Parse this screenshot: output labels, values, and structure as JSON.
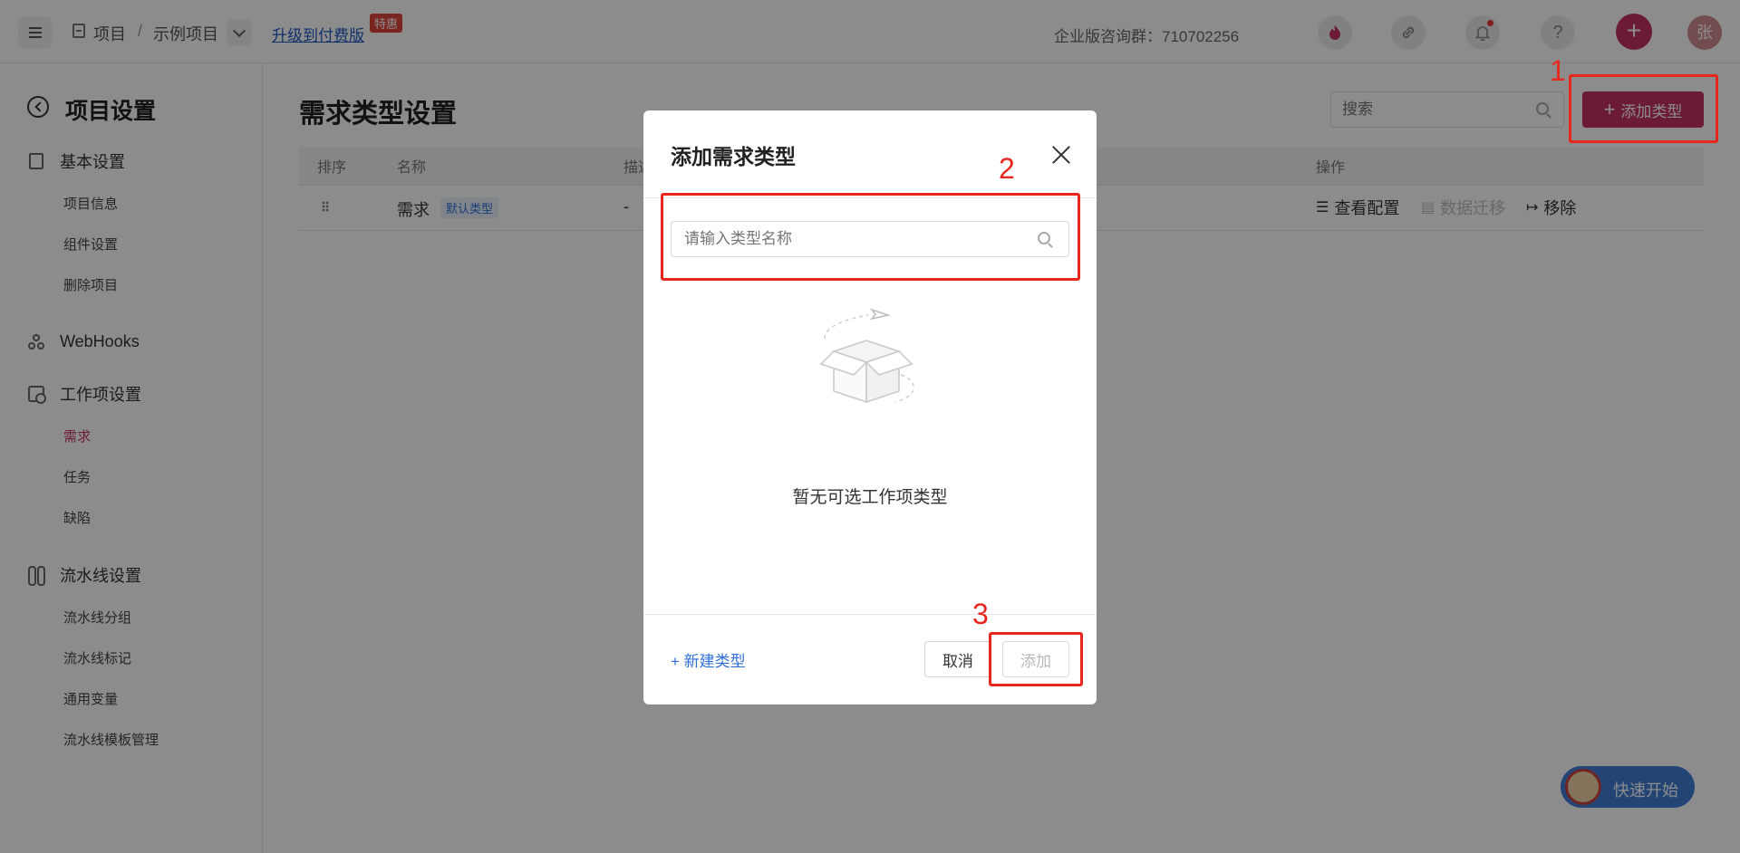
{
  "topbar": {
    "breadcrumb_root": "项目",
    "breadcrumb_sep": "/",
    "breadcrumb_project": "示例项目",
    "upgrade_link": "升级到付费版",
    "hot_badge": "特惠",
    "consult_text": "企业版咨询群：710702256",
    "help_glyph": "?",
    "plus_glyph": "+",
    "avatar_text": "张"
  },
  "sidebar": {
    "back_title": "项目设置",
    "sections": [
      {
        "label": "基本设置",
        "items": [
          "项目信息",
          "组件设置",
          "删除项目"
        ]
      },
      {
        "label": "WebHooks",
        "items": []
      },
      {
        "label": "工作项设置",
        "items": [
          "需求",
          "任务",
          "缺陷"
        ],
        "active": "需求"
      },
      {
        "label": "流水线设置",
        "items": [
          "流水线分组",
          "流水线标记",
          "通用变量",
          "流水线模板管理"
        ]
      }
    ]
  },
  "main": {
    "title": "需求类型设置",
    "search_placeholder": "搜索",
    "add_button": "添加类型",
    "table": {
      "headers": [
        "排序",
        "名称",
        "描述",
        "操作"
      ],
      "rows": [
        {
          "name": "需求",
          "tag": "默认类型",
          "desc": "-"
        }
      ],
      "ops": [
        "查看配置",
        "数据迁移",
        "移除"
      ]
    }
  },
  "modal": {
    "title": "添加需求类型",
    "search_placeholder": "请输入类型名称",
    "empty_text": "暂无可选工作项类型",
    "new_type_link": "+ 新建类型",
    "cancel": "取消",
    "add": "添加"
  },
  "quick_start": "快速开始",
  "annotations": [
    "1",
    "2",
    "3"
  ],
  "colors": {
    "brand": "#c4325f",
    "link": "#2f6fd6",
    "annotation": "#e8261e"
  }
}
